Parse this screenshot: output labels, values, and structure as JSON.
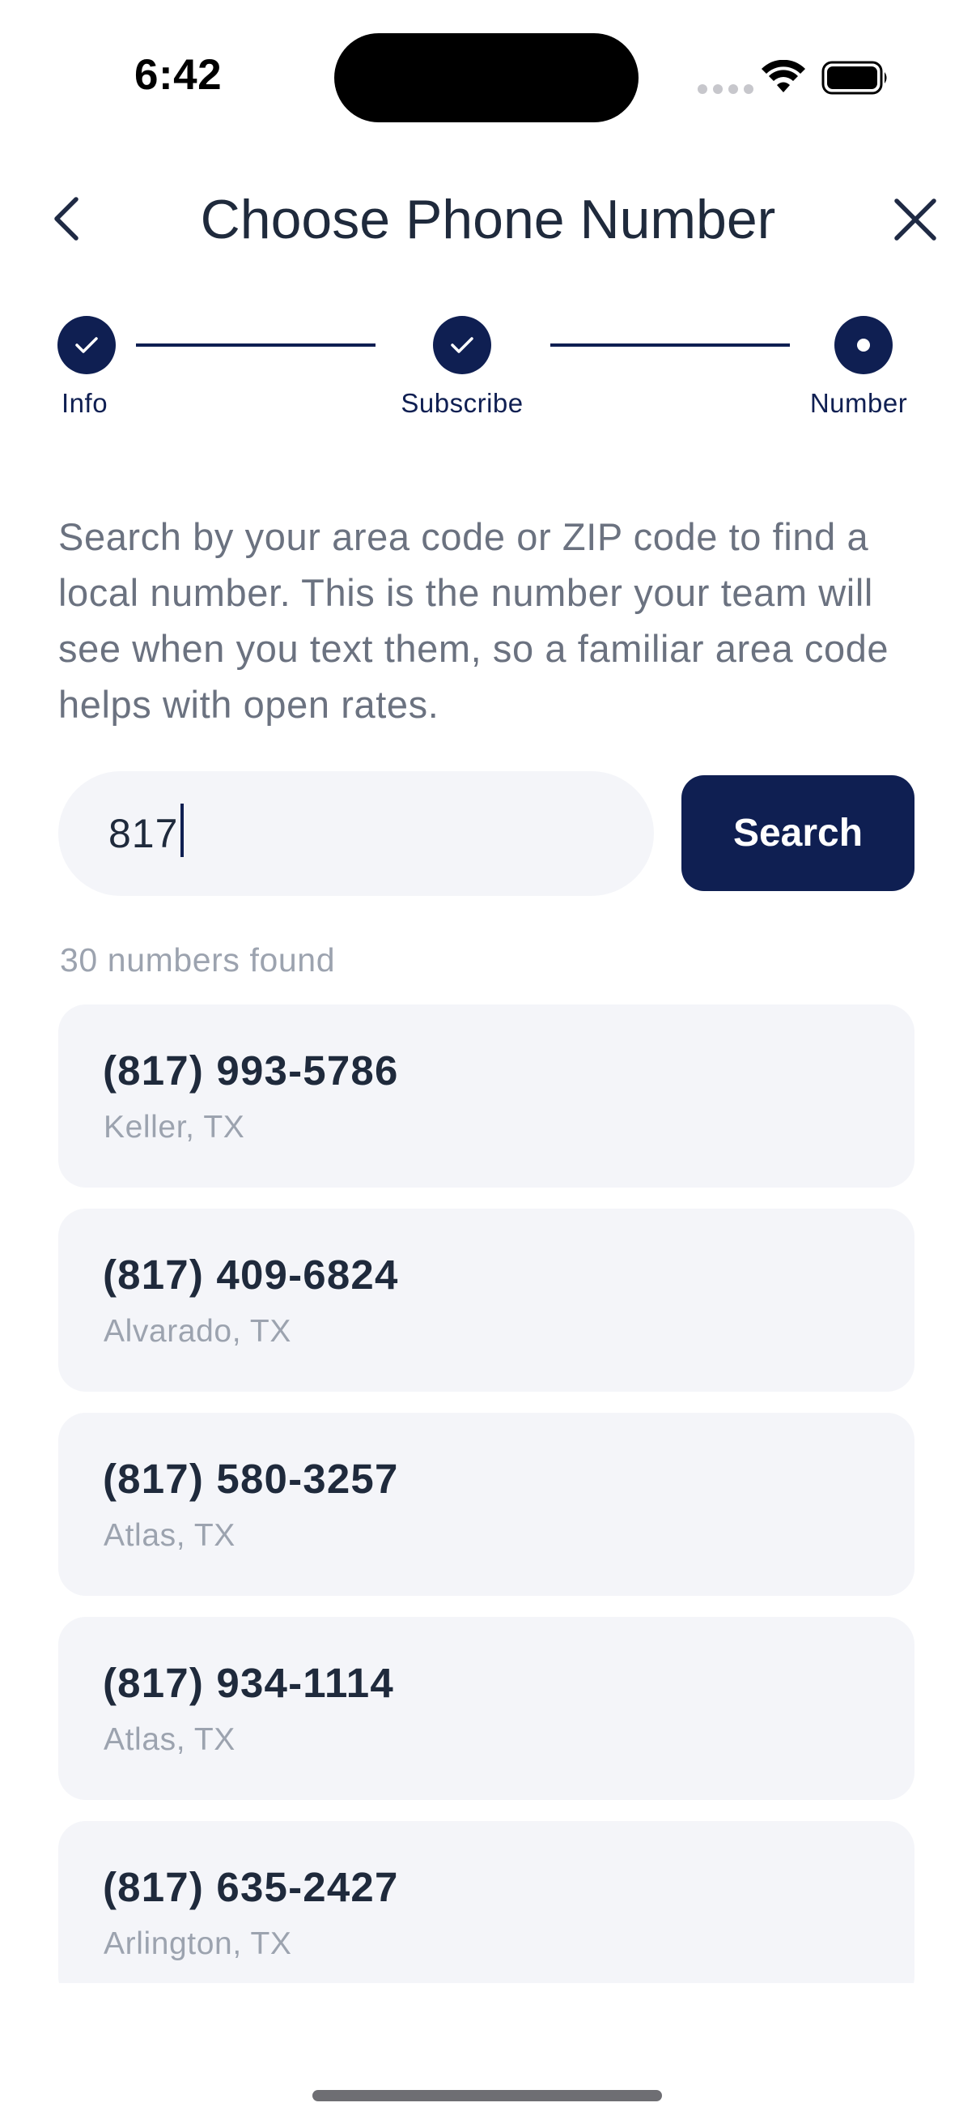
{
  "status_bar": {
    "time": "6:42"
  },
  "header": {
    "title": "Choose Phone Number",
    "back_icon": "chevron-left-icon",
    "close_icon": "close-icon"
  },
  "stepper": {
    "steps": [
      {
        "label": "Info",
        "state": "complete"
      },
      {
        "label": "Subscribe",
        "state": "complete"
      },
      {
        "label": "Number",
        "state": "current"
      }
    ]
  },
  "description": "Search by your area code or ZIP code to find a local number. This is the number your team will see when you text them, so a familiar area code helps with open rates.",
  "search": {
    "value": "817",
    "button_label": "Search"
  },
  "results": {
    "count_label": "30 numbers found",
    "items": [
      {
        "number": "(817) 993-5786",
        "location": "Keller, TX"
      },
      {
        "number": "(817) 409-6824",
        "location": "Alvarado, TX"
      },
      {
        "number": "(817) 580-3257",
        "location": "Atlas, TX"
      },
      {
        "number": "(817) 934-1114",
        "location": "Atlas, TX"
      },
      {
        "number": "(817) 635-2427",
        "location": "Arlington, TX"
      }
    ]
  },
  "colors": {
    "primary": "#0f1f52",
    "card_background": "#f4f5f9",
    "muted_text": "#9ca3af",
    "body_text": "#6b7280"
  }
}
